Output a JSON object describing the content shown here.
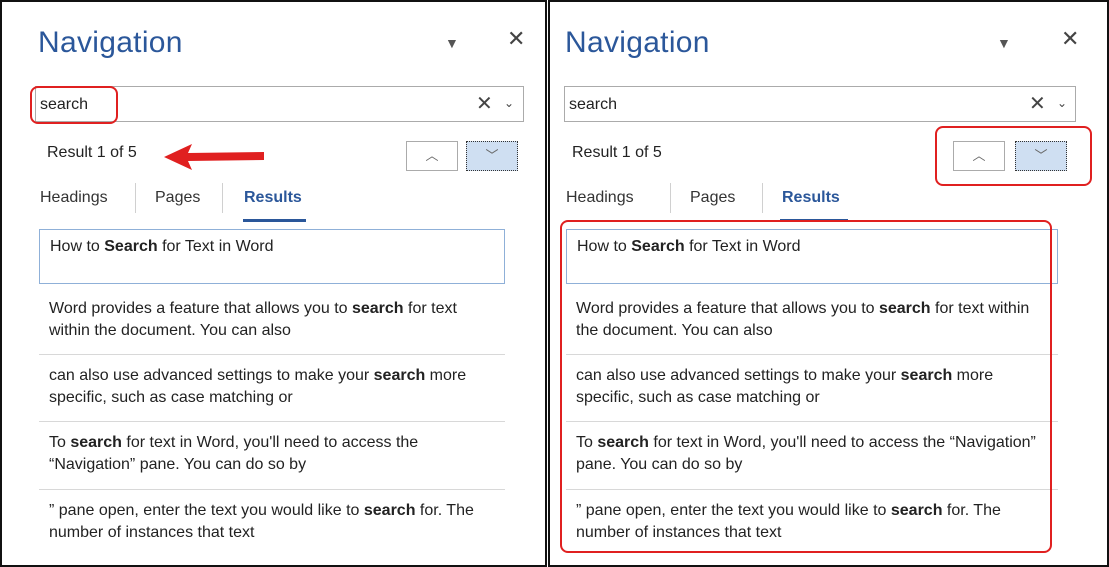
{
  "left_pane": {
    "title": "Navigation",
    "search_value": "search",
    "result_text": "Result 1 of 5",
    "tabs": [
      "Headings",
      "Pages",
      "Results"
    ],
    "results": [
      {
        "pre": "How to ",
        "bold": "Search",
        "post": " for Text in Word"
      },
      {
        "pre": "Word provides a feature that allows you to ",
        "bold": "search",
        "post": " for text within the document. You can also"
      },
      {
        "pre": "can also use advanced settings to make your ",
        "bold": "search",
        "post": " more specific, such as case matching or"
      },
      {
        "pre": "To ",
        "bold": "search",
        "post": " for text in Word, you'll need to access the “Navigation” pane. You can do so by"
      },
      {
        "pre": "” pane open, enter the text you would like to ",
        "bold": "search",
        "post": " for. The number of instances that text"
      }
    ]
  },
  "right_pane": {
    "title": "Navigation",
    "search_value": "search",
    "result_text": "Result 1 of 5",
    "tabs": [
      "Headings",
      "Pages",
      "Results"
    ]
  },
  "icons": {
    "pin": "▼",
    "close": "✕",
    "clear": "✕",
    "dropdown": "⌄",
    "up": "︿",
    "down": "﹀"
  },
  "colors": {
    "accent": "#2b579a",
    "highlight": "#e02020"
  }
}
